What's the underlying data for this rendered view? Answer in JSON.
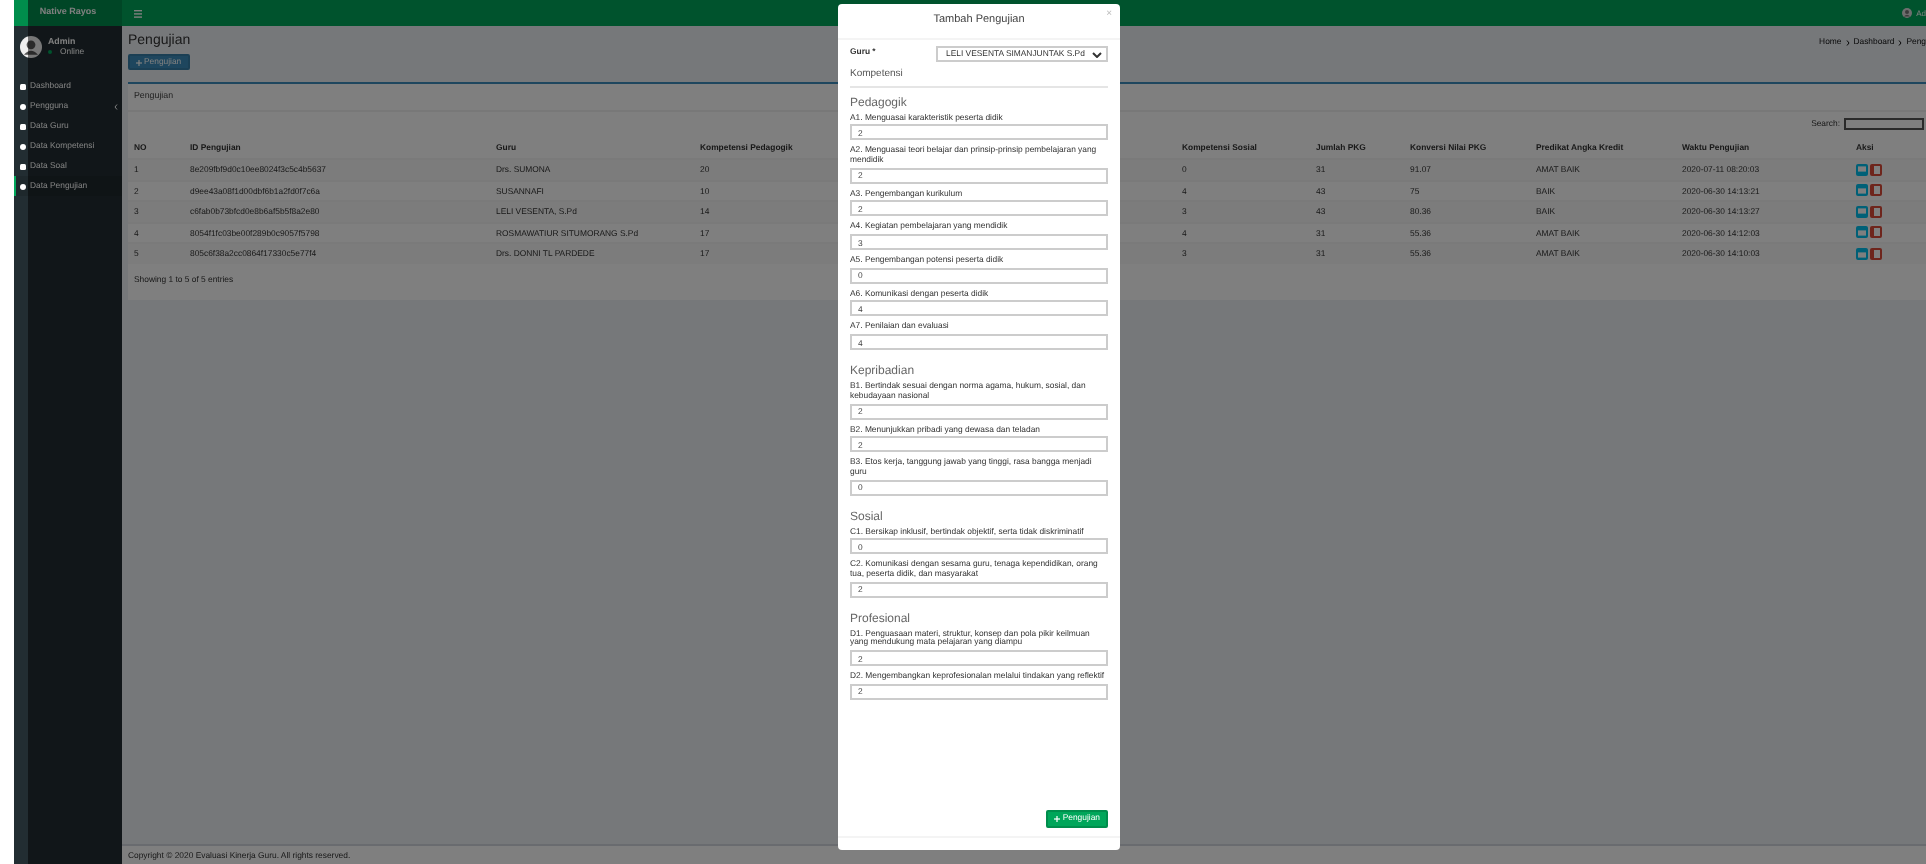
{
  "navbar": {
    "brand": "Native Rayos",
    "user": "Ad"
  },
  "sidebar": {
    "user_name": "Admin",
    "status": "Online",
    "items": [
      {
        "label": "Dashboard",
        "selected": false,
        "submenu": false
      },
      {
        "label": "Pengguna",
        "selected": false,
        "submenu": true
      },
      {
        "label": "Data Guru",
        "selected": false,
        "submenu": false
      },
      {
        "label": "Data Kompetensi",
        "selected": false,
        "submenu": false
      },
      {
        "label": "Data Soal",
        "selected": false,
        "submenu": false
      },
      {
        "label": "Data Pengujian",
        "selected": true,
        "submenu": false
      }
    ]
  },
  "page": {
    "title": "Pengujian",
    "add_button": "Pengujian",
    "breadcrumb": [
      "Home",
      "Dashboard",
      "Peng"
    ]
  },
  "card": {
    "title": "Pengujian",
    "search_label": "Search:",
    "table": {
      "columns": [
        "NO",
        "ID Pengujian",
        "Guru",
        "Kompetensi Pedagogik",
        "Kompetensi Sosial",
        "Jumlah PKG",
        "Konversi Nilai PKG",
        "Predikat Angka Kredit",
        "Waktu Pengujian",
        "Aksi"
      ],
      "rows": [
        [
          "1",
          "8e209fbf9d0c10ee8024f3c5c4b5637",
          "Drs. SUMONA",
          "20",
          "0",
          "31",
          "91.07",
          "AMAT BAIK",
          "2020-07-11 08:20:03"
        ],
        [
          "2",
          "d9ee43a08f1d00dbf6b1a2fd0f7c6a",
          "SUSANNAFI",
          "10",
          "4",
          "43",
          "75",
          "BAIK",
          "2020-06-30 14:13:21"
        ],
        [
          "3",
          "c6fab0b73bfcd0e8b6af5b5f8a2e80",
          "LELI VESENTA, S.Pd",
          "14",
          "3",
          "43",
          "80.36",
          "BAIK",
          "2020-06-30 14:13:27"
        ],
        [
          "4",
          "8054f1fc03be00f289b0c9057f5798",
          "ROSMAWATIUR SITUMORANG S.Pd",
          "17",
          "4",
          "31",
          "55.36",
          "AMAT BAIK",
          "2020-06-30 14:12:03"
        ],
        [
          "5",
          "805c6f38a2cc0864f17330c5e77f4",
          "Drs. DONNI TL PARDEDE",
          "17",
          "3",
          "31",
          "55.36",
          "AMAT BAIK",
          "2020-06-30 14:10:03"
        ]
      ]
    },
    "info": "Showing 1 to 5 of 5 entries"
  },
  "footer": {
    "before": "Copyright © 2020",
    "link": "Evaluasi Kinerja Guru.",
    "after": "All rights reserved."
  },
  "modal": {
    "title": "Tambah Pengujian",
    "close": "×",
    "guru_label": "Guru *",
    "guru_value": "LELI VESENTA SIMANJUNTAK S.Pd",
    "heading": "Kompetensi",
    "sections": [
      {
        "title": "Pedagogik",
        "items": [
          {
            "label": "A1. Menguasai karakteristik peserta didik",
            "value": "2"
          },
          {
            "label": "A2. Menguasai teori belajar dan prinsip-prinsip pembelajaran yang mendidik",
            "value": "2"
          },
          {
            "label": "A3. Pengembangan kurikulum",
            "value": "2"
          },
          {
            "label": "A4. Kegiatan pembelajaran yang mendidik",
            "value": "3"
          },
          {
            "label": "A5. Pengembangan potensi peserta didik",
            "value": "0"
          },
          {
            "label": "A6. Komunikasi dengan peserta didik",
            "value": "4"
          },
          {
            "label": "A7. Penilaian dan evaluasi",
            "value": "4"
          }
        ]
      },
      {
        "title": "Kepribadian",
        "items": [
          {
            "label": "B1. Bertindak sesuai dengan norma agama, hukum, sosial, dan kebudayaan nasional",
            "value": "2"
          },
          {
            "label": "B2. Menunjukkan pribadi yang dewasa dan teladan",
            "value": "2"
          },
          {
            "label": "B3. Etos kerja, tanggung jawab yang tinggi, rasa bangga menjadi guru",
            "value": "0"
          }
        ]
      },
      {
        "title": "Sosial",
        "items": [
          {
            "label": "C1. Bersikap inklusif, bertindak objektif, serta tidak diskriminatif",
            "value": "0"
          },
          {
            "label": "C2. Komunikasi dengan sesama guru, tenaga kependidikan, orang tua, peserta didik, dan masyarakat",
            "value": "2"
          }
        ]
      },
      {
        "title": "Profesional",
        "items": [
          {
            "label": "D1. Penguasaan materi, struktur, konsep dan pola pikir keilmuan yang mendukung mata pelajaran yang diampu",
            "value": "2"
          },
          {
            "label": "D2. Mengembangkan keprofesionalan melalui tindakan yang reflektif",
            "value": "2"
          }
        ]
      }
    ],
    "submit_button": "Pengujian"
  }
}
